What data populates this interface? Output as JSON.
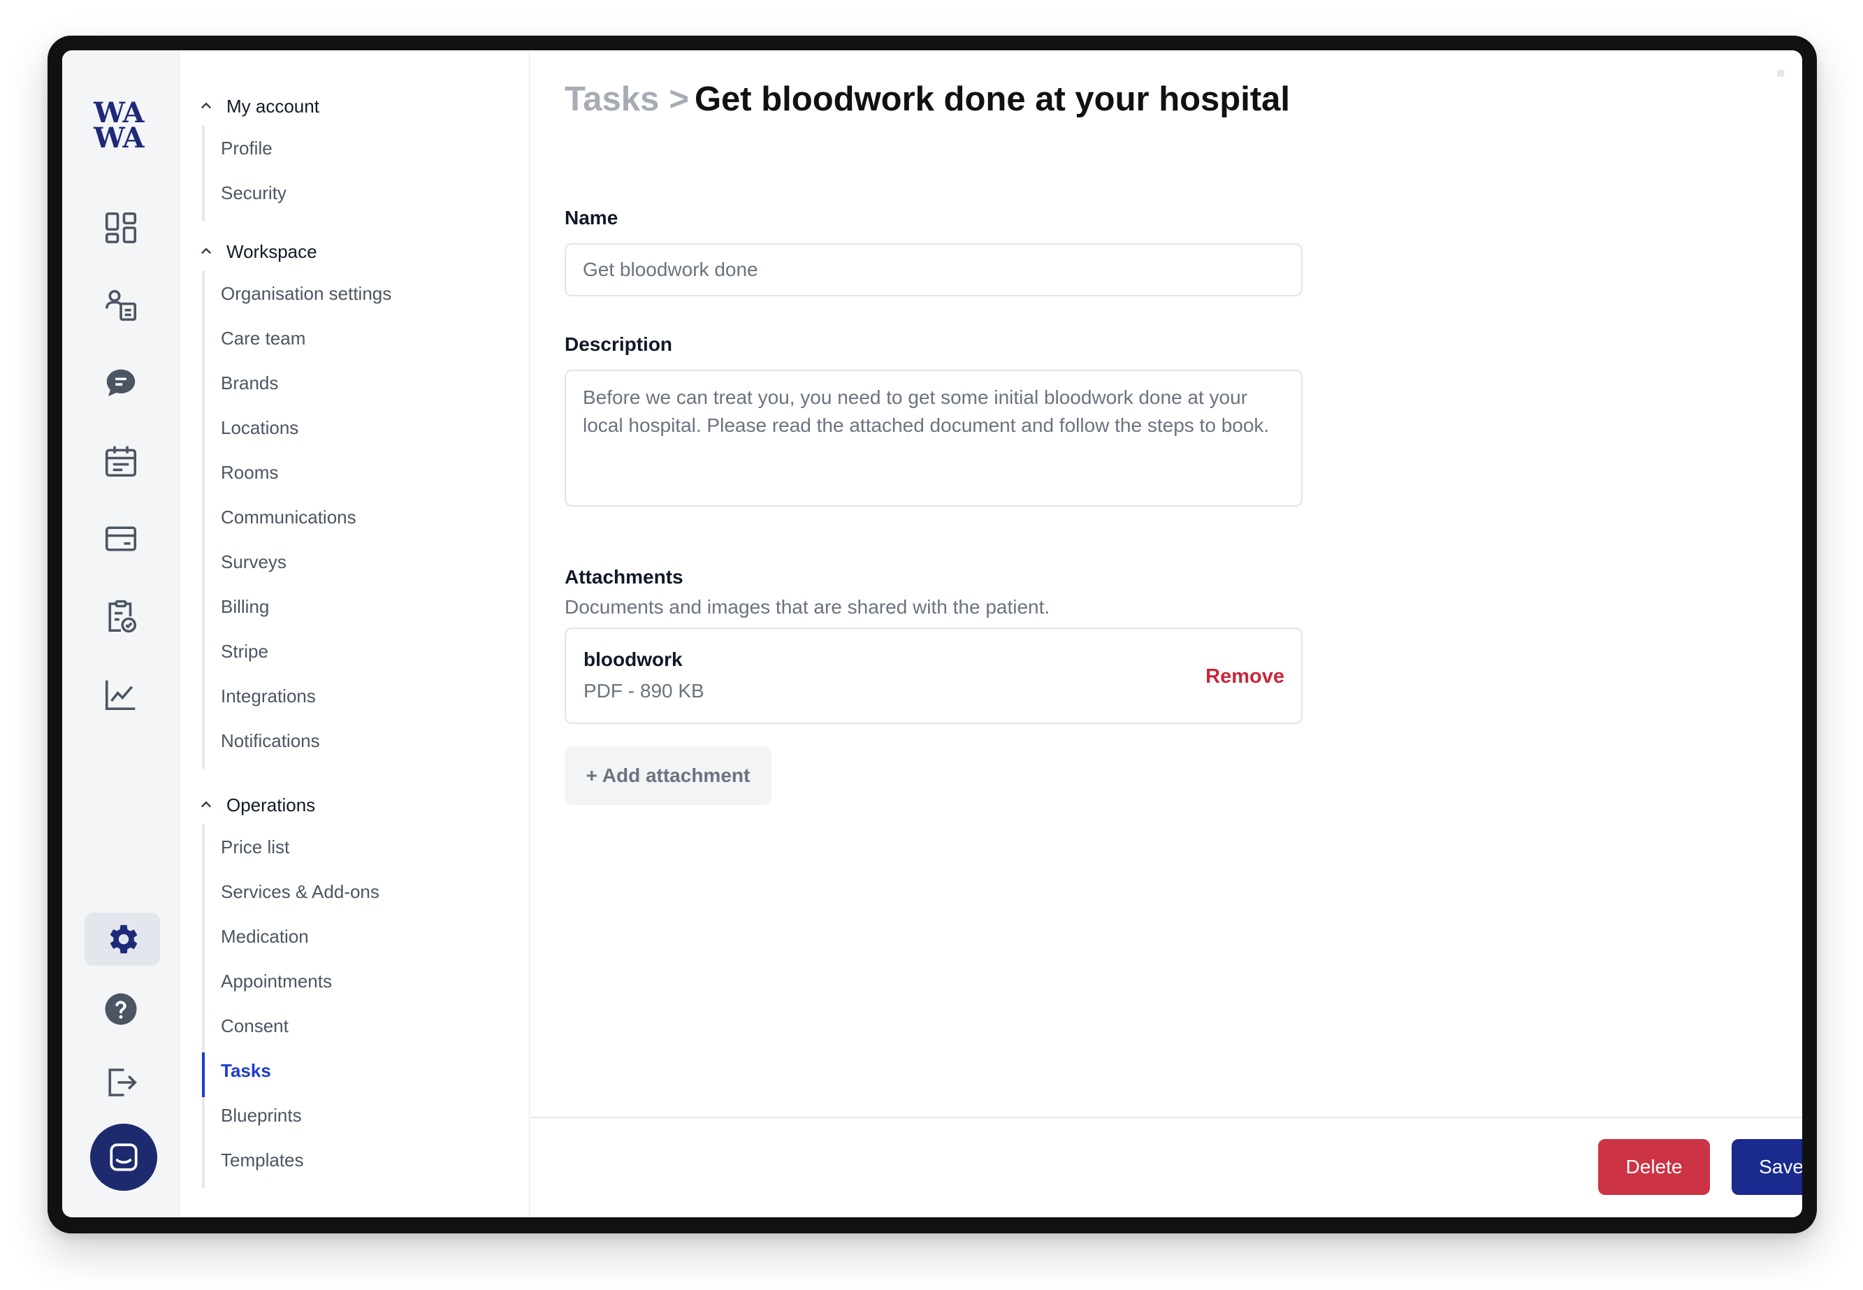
{
  "app": {
    "logo_line1": "WA",
    "logo_line2": "WA"
  },
  "rail": {
    "icons": [
      "dashboard-icon",
      "patients-icon",
      "messages-icon",
      "calendar-icon",
      "payments-icon",
      "tasks-clipboard-icon",
      "analytics-icon",
      "settings-gear-icon",
      "help-icon",
      "logout-icon",
      "chat-support-icon"
    ],
    "active": "settings-gear-icon",
    "accent_color": "#1e2a78"
  },
  "nav": {
    "groups": [
      {
        "label": "My account",
        "items": [
          "Profile",
          "Security"
        ]
      },
      {
        "label": "Workspace",
        "items": [
          "Organisation settings",
          "Care team",
          "Brands",
          "Locations",
          "Rooms",
          "Communications",
          "Surveys",
          "Billing",
          "Stripe",
          "Integrations",
          "Notifications"
        ]
      },
      {
        "label": "Operations",
        "items": [
          "Price list",
          "Services & Add-ons",
          "Medication",
          "Appointments",
          "Consent",
          "Tasks",
          "Blueprints",
          "Templates"
        ]
      }
    ],
    "active_item": "Tasks",
    "active_color": "#1d3bd1"
  },
  "main": {
    "breadcrumb_parent": "Tasks",
    "breadcrumb_separator": ">",
    "title": "Get bloodwork done at your hospital",
    "name_label": "Name",
    "name_value": "Get bloodwork done",
    "description_label": "Description",
    "description_value": "Before we can treat you, you need to get some initial bloodwork done at your local hospital. Please read the attached document and follow the steps to book.",
    "attachments_label": "Attachments",
    "attachments_helper": "Documents and images that are shared with the patient.",
    "attachment": {
      "name": "bloodwork",
      "meta": "PDF - 890 KB",
      "remove_label": "Remove"
    },
    "add_attachment_label": "+ Add attachment"
  },
  "footer": {
    "delete_label": "Delete",
    "save_label": "Save",
    "delete_color": "#cc3344",
    "save_color": "#1a2a8e"
  }
}
